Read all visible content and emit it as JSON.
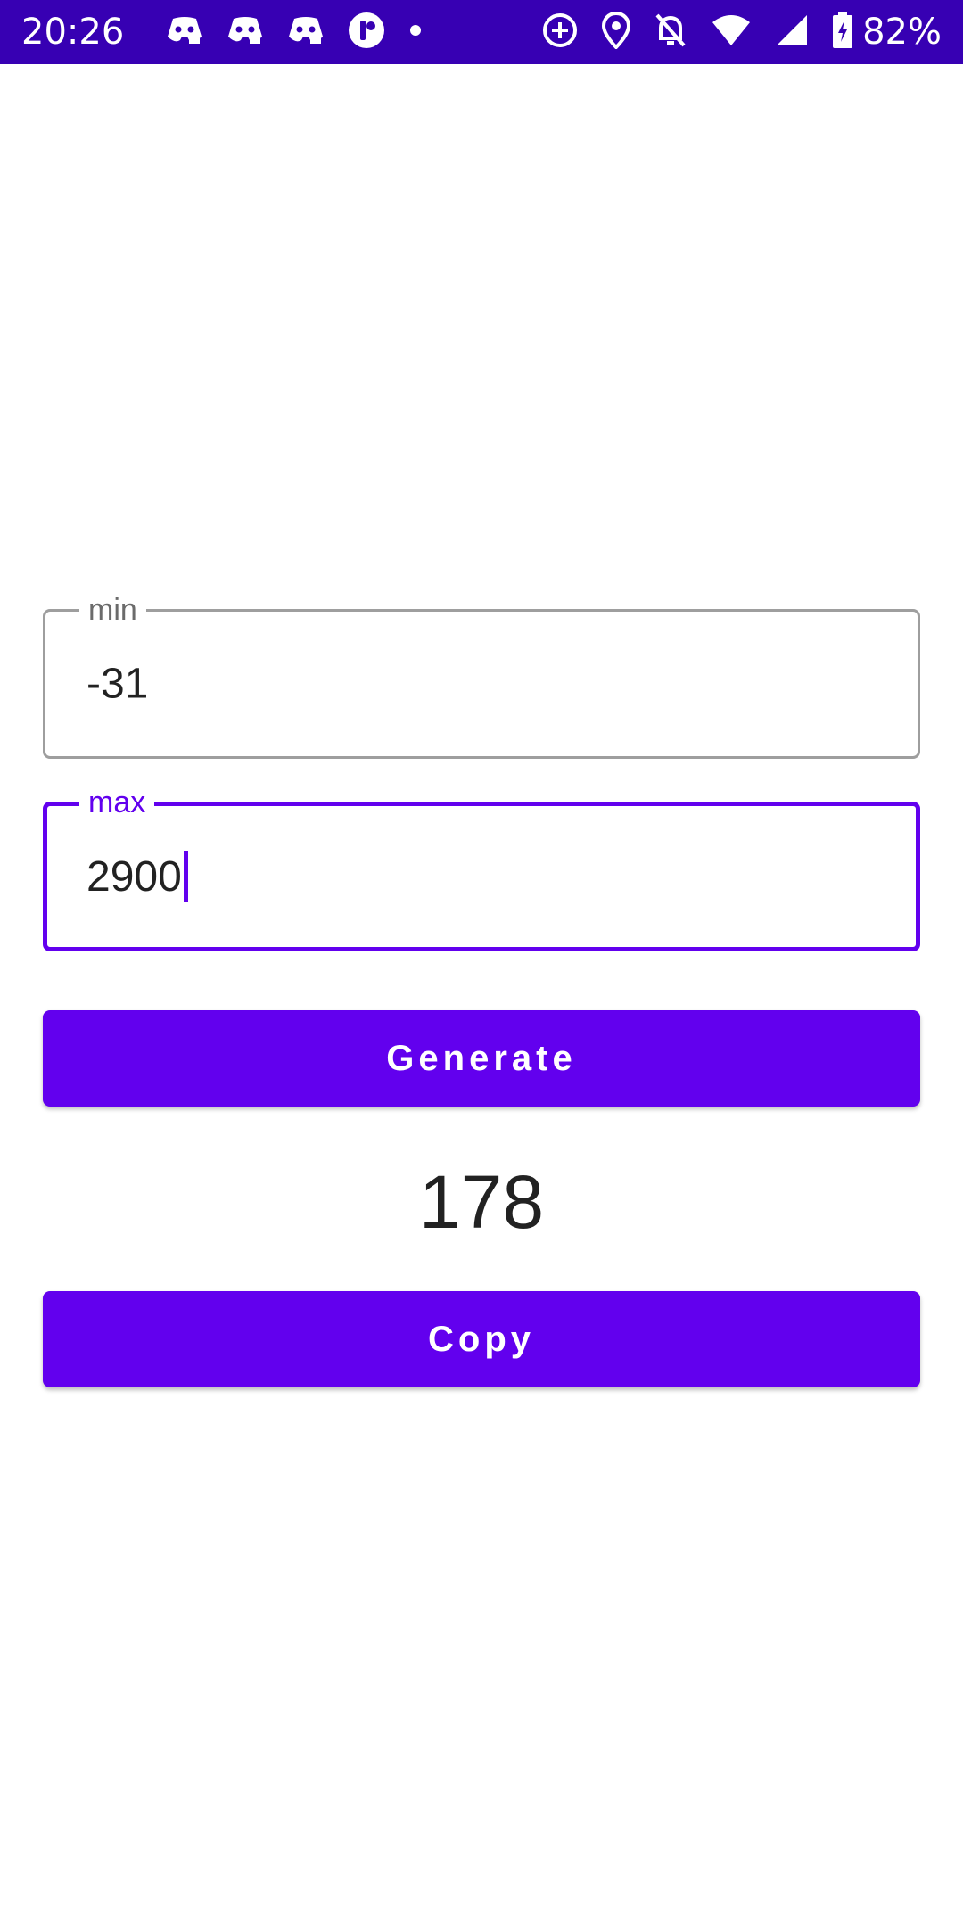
{
  "status_bar": {
    "time": "20:26",
    "battery": "82%",
    "left_icons": [
      "discord-icon",
      "discord-icon",
      "discord-icon",
      "app-icon",
      "dot-icon"
    ],
    "right_icons": [
      "data-saver-icon",
      "location-icon",
      "bell-off-icon",
      "wifi-icon",
      "signal-icon",
      "battery-charging-icon"
    ]
  },
  "form": {
    "min": {
      "label": "min",
      "value": "-31"
    },
    "max": {
      "label": "max",
      "value": "2900"
    }
  },
  "buttons": {
    "generate": "Generate",
    "copy": "Copy"
  },
  "result": "178",
  "colors": {
    "status_bar": "#3700b3",
    "primary": "#6200ee",
    "field_border": "#9e9e9e",
    "text": "#222222"
  }
}
